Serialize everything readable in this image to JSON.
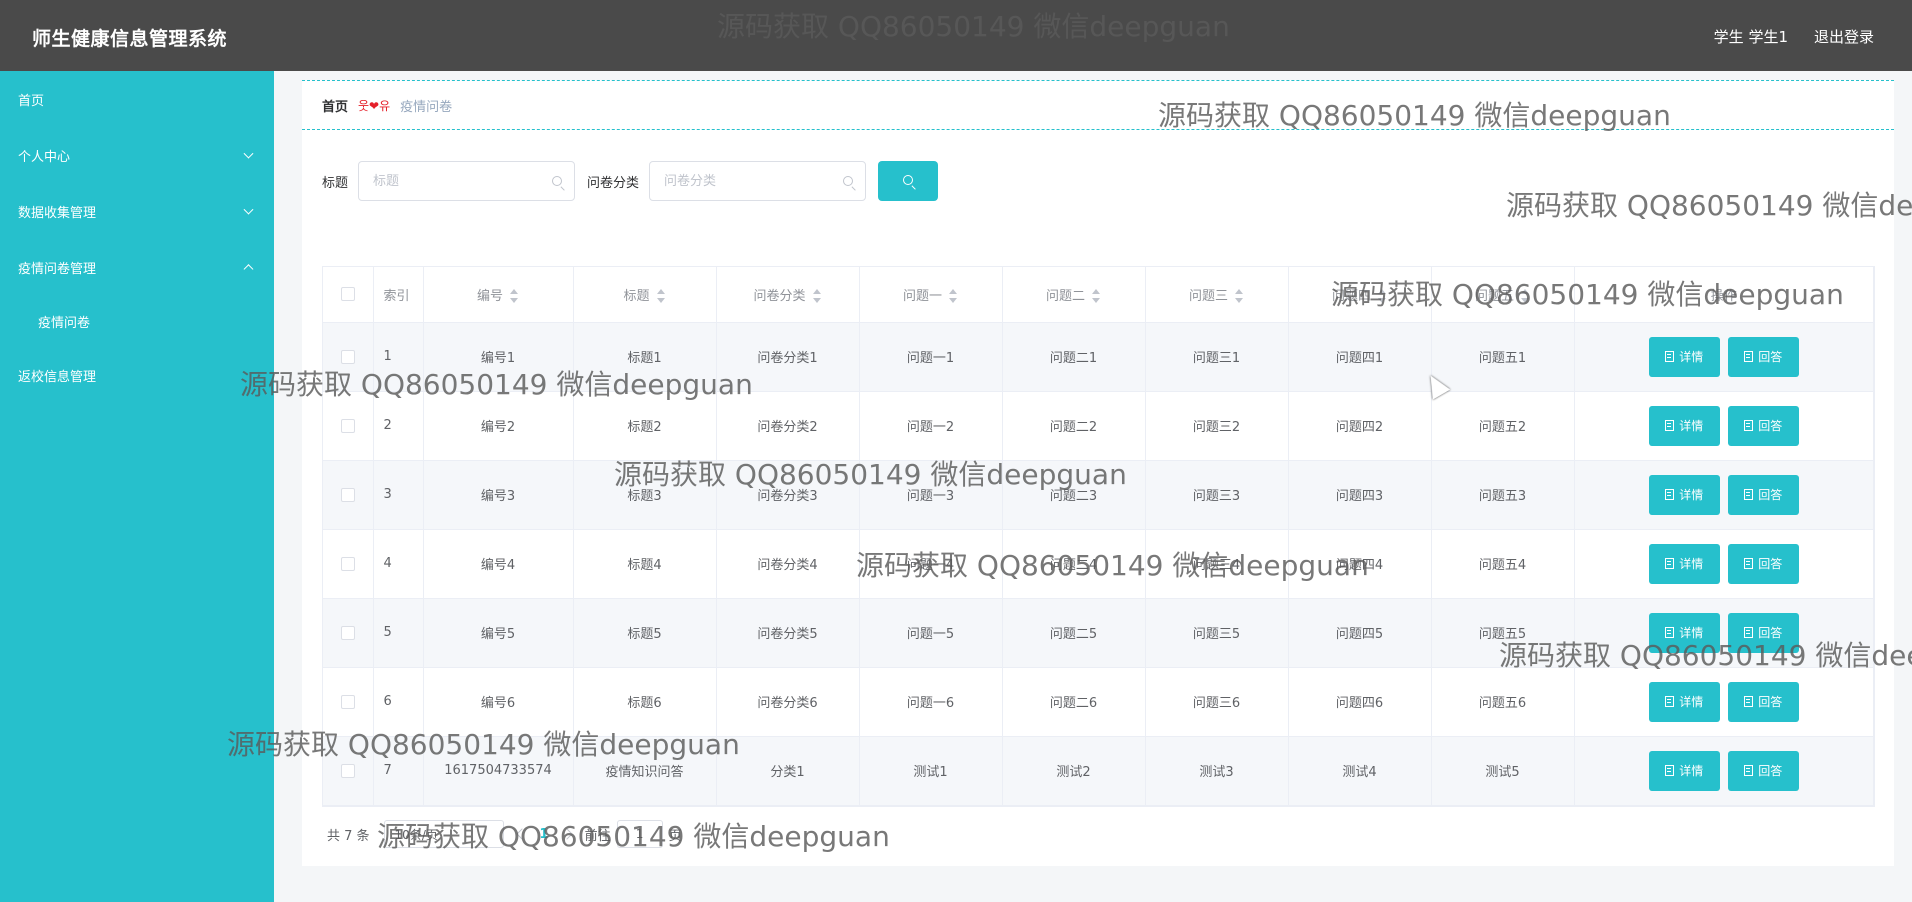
{
  "header": {
    "title": "师生健康信息管理系统",
    "user": "学生 学生1",
    "logout": "退出登录"
  },
  "sidebar": {
    "items": [
      {
        "label": "首页"
      },
      {
        "label": "个人中心"
      },
      {
        "label": "数据收集管理"
      },
      {
        "label": "疫情问卷管理"
      },
      {
        "label": "疫情问卷"
      },
      {
        "label": "返校信息管理"
      }
    ]
  },
  "breadcrumb": {
    "home": "首页",
    "separator": "웃❤유",
    "current": "疫情问卷"
  },
  "search": {
    "title_label": "标题",
    "title_placeholder": "标题",
    "category_label": "问卷分类",
    "category_placeholder": "问卷分类"
  },
  "table": {
    "headers": [
      "索引",
      "编号",
      "标题",
      "问卷分类",
      "问题一",
      "问题二",
      "问题三",
      "问题四",
      "问题五",
      "操作"
    ],
    "detail_label": "详情",
    "answer_label": "回答",
    "rows": [
      [
        "1",
        "编号1",
        "标题1",
        "问卷分类1",
        "问题一1",
        "问题二1",
        "问题三1",
        "问题四1",
        "问题五1"
      ],
      [
        "2",
        "编号2",
        "标题2",
        "问卷分类2",
        "问题一2",
        "问题二2",
        "问题三2",
        "问题四2",
        "问题五2"
      ],
      [
        "3",
        "编号3",
        "标题3",
        "问卷分类3",
        "问题一3",
        "问题二3",
        "问题三3",
        "问题四3",
        "问题五3"
      ],
      [
        "4",
        "编号4",
        "标题4",
        "问卷分类4",
        "问题一4",
        "问题二4",
        "问题三4",
        "问题四4",
        "问题五4"
      ],
      [
        "5",
        "编号5",
        "标题5",
        "问卷分类5",
        "问题一5",
        "问题二5",
        "问题三5",
        "问题四5",
        "问题五5"
      ],
      [
        "6",
        "编号6",
        "标题6",
        "问卷分类6",
        "问题一6",
        "问题二6",
        "问题三6",
        "问题四6",
        "问题五6"
      ],
      [
        "7",
        "1617504733574",
        "疫情知识问答",
        "分类1",
        "测试1",
        "测试2",
        "测试3",
        "测试4",
        "测试5"
      ]
    ]
  },
  "pagination": {
    "total": "共 7 条",
    "page_size": "10条/页",
    "current_page": "1",
    "goto_label": "前往",
    "goto_value": "1",
    "page_suffix": "页"
  },
  "watermark": "源码获取 QQ86050149 微信deepguan",
  "colors": {
    "accent": "#26c0cc",
    "header": "#4a4a4a"
  }
}
